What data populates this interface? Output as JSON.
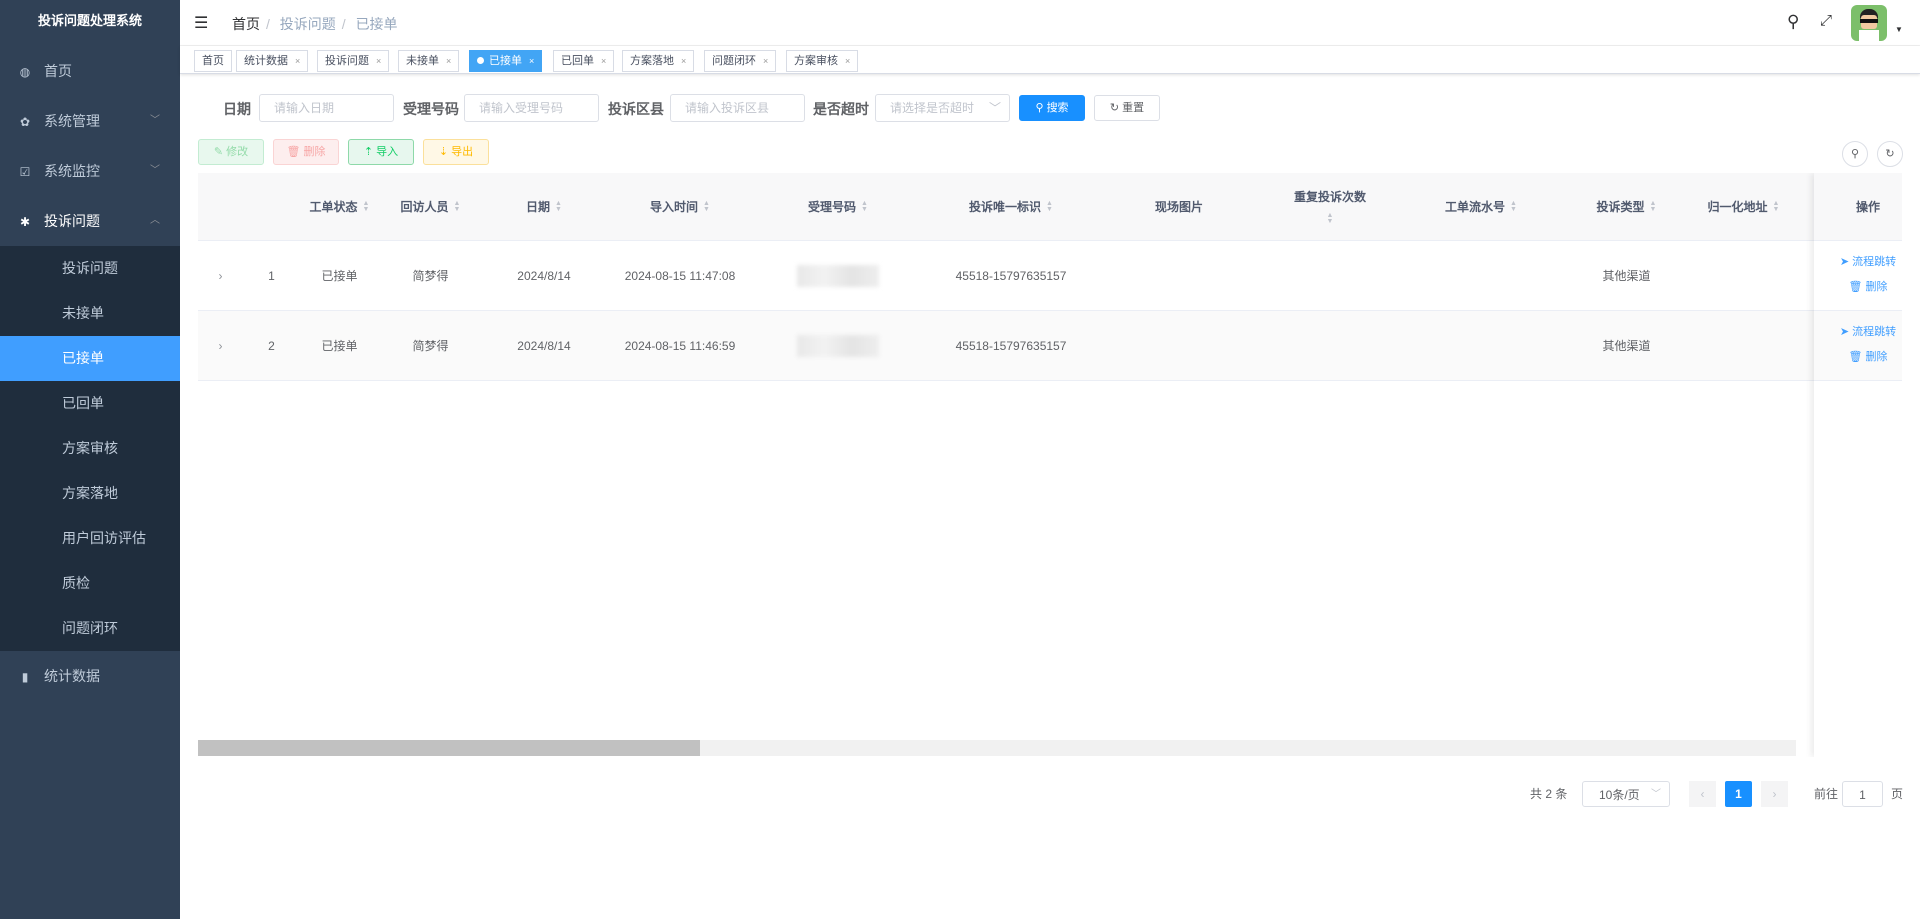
{
  "app": {
    "title": "投诉问题处理系统"
  },
  "sidebar": {
    "items": [
      {
        "label": "首页",
        "icon": "dashboard-icon"
      },
      {
        "label": "系统管理",
        "icon": "gear-icon"
      },
      {
        "label": "系统监控",
        "icon": "monitor-icon"
      },
      {
        "label": "投诉问题",
        "icon": "bug-icon"
      },
      {
        "label": "统计数据",
        "icon": "bar-chart-icon"
      }
    ],
    "sub_items": [
      "投诉问题",
      "未接单",
      "已接单",
      "已回单",
      "方案审核",
      "方案落地",
      "用户回访评估",
      "质检",
      "问题闭环"
    ],
    "active_sub": "已接单"
  },
  "breadcrumb": [
    "首页",
    "投诉问题",
    "已接单"
  ],
  "tags": [
    "首页",
    "统计数据",
    "投诉问题",
    "未接单",
    "已接单",
    "已回单",
    "方案落地",
    "问题闭环",
    "方案审核"
  ],
  "search": {
    "date_label": "日期",
    "date_placeholder": "请输入日期",
    "accept_label": "受理号码",
    "accept_placeholder": "请输入受理号码",
    "district_label": "投诉区县",
    "district_placeholder": "请输入投诉区县",
    "timeout_label": "是否超时",
    "timeout_placeholder": "请选择是否超时",
    "search_btn": "搜索",
    "reset_btn": "重置"
  },
  "toolbar": {
    "edit": "修改",
    "delete": "删除",
    "import": "导入",
    "export": "导出"
  },
  "table": {
    "columns": [
      "工单状态",
      "回访人员",
      "日期",
      "导入时间",
      "受理号码",
      "投诉唯一标识",
      "现场图片",
      "重复投诉次数",
      "工单流水号",
      "投诉类型",
      "归一化地址",
      "操作"
    ],
    "rows": [
      {
        "index": "1",
        "status": "已接单",
        "visitor": "简梦得",
        "date": "2024/8/14",
        "import_time": "2024-08-15 11:47:08",
        "unique_id": "45518-15797635157",
        "type": "其他渠道"
      },
      {
        "index": "2",
        "status": "已接单",
        "visitor": "简梦得",
        "date": "2024/8/14",
        "import_time": "2024-08-15 11:46:59",
        "unique_id": "45518-15797635157",
        "type": "其他渠道"
      }
    ],
    "action_flow": "流程跳转",
    "action_delete": "删除"
  },
  "pagination": {
    "total": "共 2 条",
    "page_size": "10条/页",
    "current": "1",
    "goto_label": "前往",
    "goto_value": "1",
    "page_suffix": "页"
  },
  "colors": {
    "sidebar": "#304156",
    "accent": "#409eff",
    "tag_active": "#42a5f5"
  }
}
